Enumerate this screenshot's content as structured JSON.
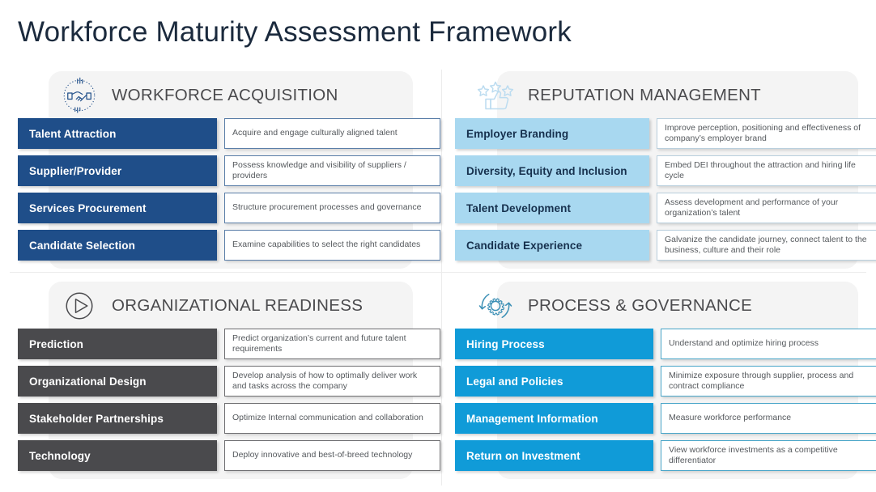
{
  "page_title": "Workforce Maturity Assessment Framework",
  "colors": {
    "navy": "#1F4E89",
    "light_blue": "#A8D8F0",
    "dark_gray": "#4A4A4D",
    "bright_blue": "#109BD8",
    "panel_bg": "#F4F4F4",
    "title_text": "#1B2A3D"
  },
  "quadrants": [
    {
      "id": "workforce-acquisition",
      "title": "WORKFORCE ACQUISITION",
      "icon": "handshake-icon",
      "rows": [
        {
          "label": "Talent Attraction",
          "desc": "Acquire and engage culturally aligned talent"
        },
        {
          "label": "Supplier/Provider",
          "desc": "Possess knowledge and visibility of suppliers / providers"
        },
        {
          "label": "Services Procurement",
          "desc": "Structure procurement processes and governance"
        },
        {
          "label": "Candidate Selection",
          "desc": "Examine capabilities to select the right candidates"
        }
      ]
    },
    {
      "id": "reputation-management",
      "title": "REPUTATION MANAGEMENT",
      "icon": "thumbs-up-stars-icon",
      "rows": [
        {
          "label": "Employer Branding",
          "desc": "Improve perception, positioning and effectiveness of company’s employer brand"
        },
        {
          "label": "Diversity, Equity and Inclusion",
          "desc": "Embed DEI throughout the attraction and hiring life cycle"
        },
        {
          "label": "Talent Development",
          "desc": "Assess development and performance of your organization’s talent"
        },
        {
          "label": "Candidate Experience",
          "desc": "Galvanize the candidate journey, connect talent to the business, culture and their role"
        }
      ]
    },
    {
      "id": "organizational-readiness",
      "title": "ORGANIZATIONAL READINESS",
      "icon": "play-circle-icon",
      "rows": [
        {
          "label": "Prediction",
          "desc": "Predict organization’s current and future talent requirements"
        },
        {
          "label": "Organizational Design",
          "desc": "Develop analysis of how to optimally deliver work and tasks across the company"
        },
        {
          "label": "Stakeholder Partnerships",
          "desc": "Optimize Internal communication and collaboration"
        },
        {
          "label": "Technology",
          "desc": "Deploy innovative and best-of-breed technology"
        }
      ]
    },
    {
      "id": "process-governance",
      "title": "PROCESS & GOVERNANCE",
      "icon": "gear-refresh-icon",
      "rows": [
        {
          "label": "Hiring Process",
          "desc": "Understand and optimize hiring process"
        },
        {
          "label": "Legal and Policies",
          "desc": "Minimize exposure through supplier, process and contract compliance"
        },
        {
          "label": "Management Information",
          "desc": "Measure workforce performance"
        },
        {
          "label": "Return on Investment",
          "desc": "View workforce investments as a competitive differentiator"
        }
      ]
    }
  ]
}
